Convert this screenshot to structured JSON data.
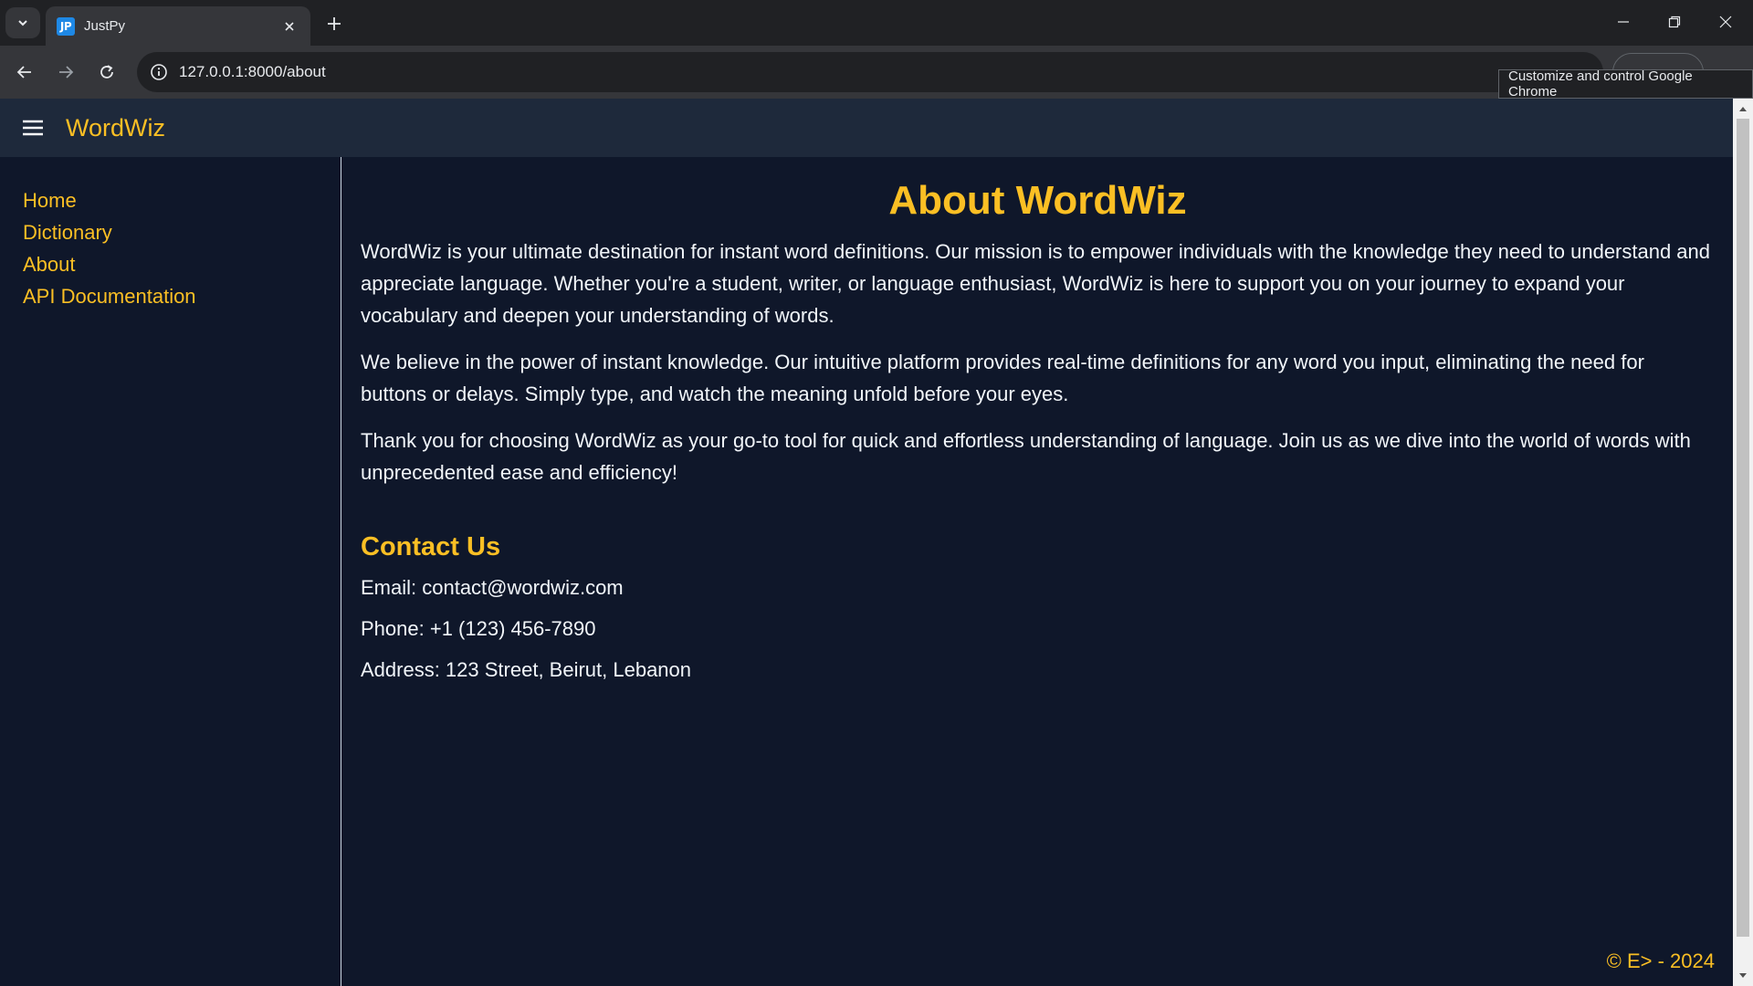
{
  "browser": {
    "tab_title": "JustPy",
    "favicon_text": "JP",
    "url": "127.0.0.1:8000/about",
    "tooltip": "Customize and control Google Chrome"
  },
  "header": {
    "brand": "WordWiz"
  },
  "sidebar": {
    "items": [
      {
        "label": "Home"
      },
      {
        "label": "Dictionary"
      },
      {
        "label": "About"
      },
      {
        "label": "API Documentation"
      }
    ]
  },
  "main": {
    "title": "About WordWiz",
    "paragraphs": [
      "WordWiz is your ultimate destination for instant word definitions. Our mission is to empower individuals with the knowledge they need to understand and appreciate language. Whether you're a student, writer, or language enthusiast, WordWiz is here to support you on your journey to expand your vocabulary and deepen your understanding of words.",
      "We believe in the power of instant knowledge. Our intuitive platform provides real-time definitions for any word you input, eliminating the need for buttons or delays. Simply type, and watch the meaning unfold before your eyes.",
      "Thank you for choosing WordWiz as your go-to tool for quick and effortless understanding of language. Join us as we dive into the world of words with unprecedented ease and efficiency!"
    ],
    "contact_title": "Contact Us",
    "contact": {
      "email": "Email: contact@wordwiz.com",
      "phone": "Phone: +1 (123) 456-7890",
      "address": "Address: 123 Street, Beirut, Lebanon"
    },
    "footer": "© E> - 2024"
  },
  "colors": {
    "accent": "#fbbf24",
    "background": "#0f172a",
    "header": "#1e293b"
  }
}
